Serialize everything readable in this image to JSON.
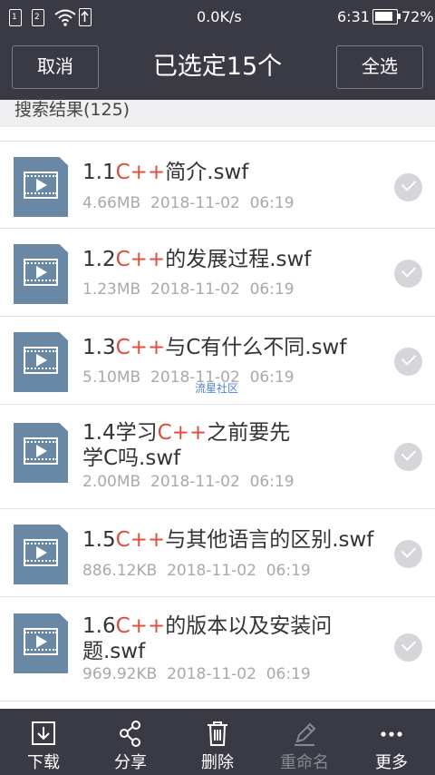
{
  "status_bar": {
    "sim1": "1",
    "sim2": "2",
    "speed": "0.0K/s",
    "time": "6:31",
    "battery": "72%"
  },
  "header": {
    "cancel_label": "取消",
    "title": "已选定15个",
    "select_all_label": "全选"
  },
  "results": {
    "label": "搜索结果(125)"
  },
  "files": [
    {
      "prefix": "1.1",
      "highlight": "C++",
      "suffix": "简介.swf",
      "line2": "",
      "size": "4.66MB",
      "date": "2018-11-02",
      "time": "06:19"
    },
    {
      "prefix": "1.2",
      "highlight": "C++",
      "suffix": "的发展过程.swf",
      "line2": "",
      "size": "1.23MB",
      "date": "2018-11-02",
      "time": "06:19"
    },
    {
      "prefix": "1.3",
      "highlight": "C++",
      "suffix": "与C有什么不同.swf",
      "line2": "",
      "size": "5.10MB",
      "date": "2018-11-02",
      "time": "06:19"
    },
    {
      "prefix": "1.4学习",
      "highlight": "C++",
      "suffix": "之前要先",
      "line2": "学C吗.swf",
      "size": "2.00MB",
      "date": "2018-11-02",
      "time": "06:19"
    },
    {
      "prefix": "1.5",
      "highlight": "C++",
      "suffix": "与其他语言的区别.swf",
      "line2": "",
      "size": "886.12KB",
      "date": "2018-11-02",
      "time": "06:19"
    },
    {
      "prefix": "1.6",
      "highlight": "C++",
      "suffix": "的版本以及安装问",
      "line2": "题.swf",
      "size": "969.92KB",
      "date": "2018-11-02",
      "time": "06:19"
    }
  ],
  "watermark": "流星社区",
  "toolbar": {
    "download": "下载",
    "share": "分享",
    "delete": "删除",
    "rename": "重命名",
    "more": "更多"
  },
  "colors": {
    "bar_bg": "#3a3a44",
    "highlight": "#e04a3a",
    "file_icon": "#6888a6"
  }
}
